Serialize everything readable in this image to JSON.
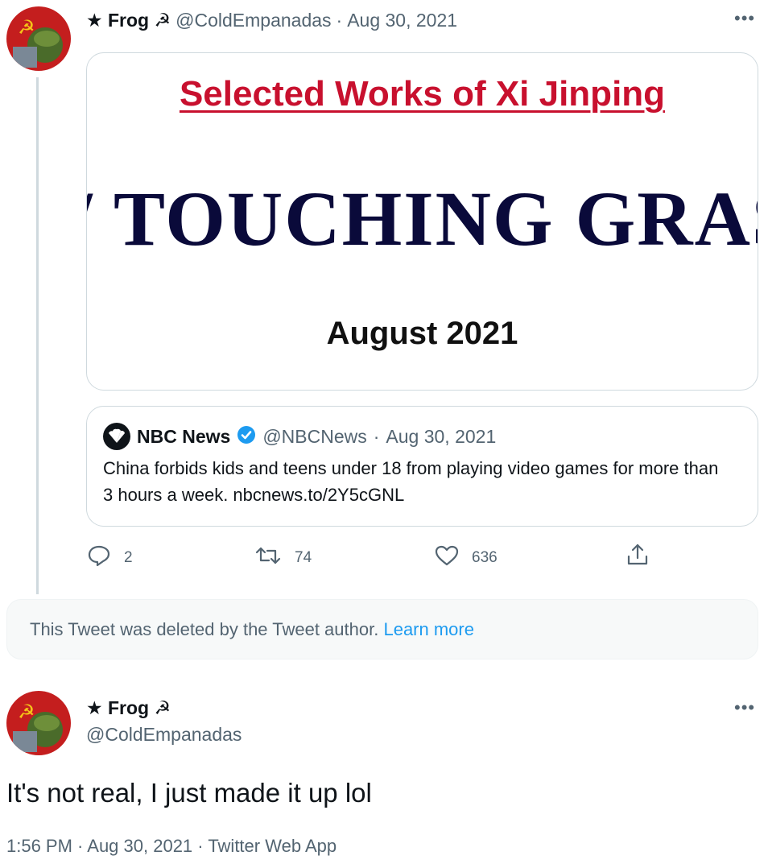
{
  "quoted_tweet": {
    "author_name": "★ Frog ☭",
    "handle": "@ColdEmpanadas",
    "separator": "·",
    "date": "Aug 30, 2021",
    "more_icon": "more-horizontal-icon",
    "media": {
      "title": "Selected Works of Xi Jinping",
      "big_text": "/ TOUCHING GRASS",
      "date": "August 2021",
      "colors": {
        "title": "#c8102e",
        "big_text": "#0a0a3a"
      }
    },
    "quote": {
      "name": "NBC News",
      "verified_icon": "verified-badge-icon",
      "handle": "@NBCNews",
      "separator": "·",
      "date": "Aug 30, 2021",
      "text": "China forbids kids and teens under 18 from playing video games for more than 3 hours a week. nbcnews.to/2Y5cGNL"
    },
    "actions": {
      "reply_count": "2",
      "retweet_count": "74",
      "like_count": "636"
    }
  },
  "deleted_notice": {
    "text": "This Tweet was deleted by the Tweet author.",
    "link": "Learn more"
  },
  "main_tweet": {
    "author_name": "★ Frog ☭",
    "handle": "@ColdEmpanadas",
    "text": "It's not real, I just made it up lol",
    "meta": "1:56 PM · Aug 30, 2021 · Twitter Web App"
  },
  "colors": {
    "accent": "#1d9bf0",
    "muted": "#536471",
    "border": "#cfd9de"
  }
}
